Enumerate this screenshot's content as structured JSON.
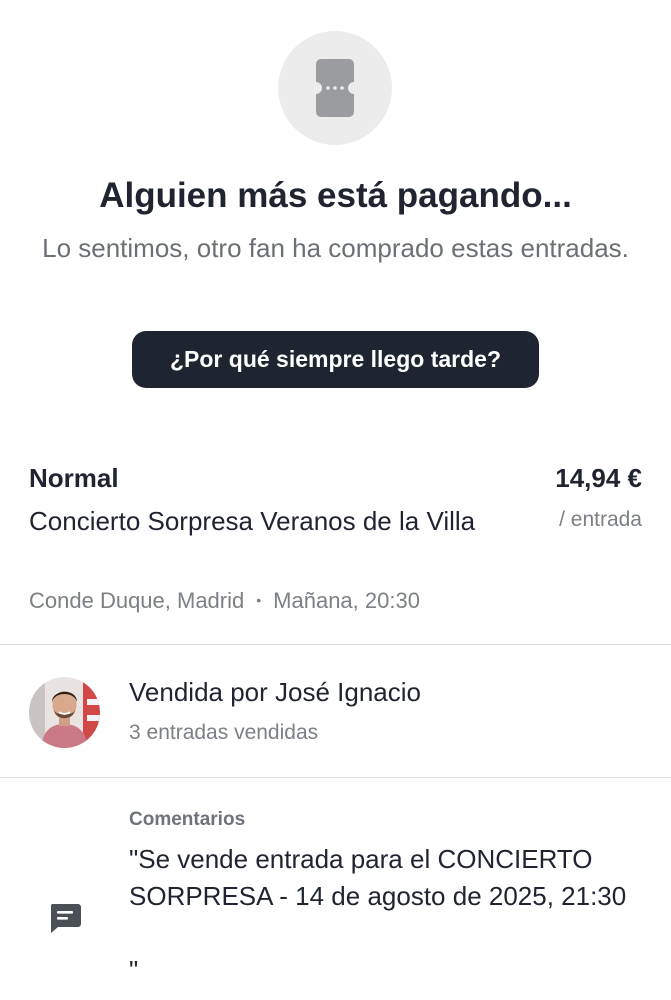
{
  "status": {
    "icon": "ticket-icon",
    "title": "Alguien más está pagando...",
    "subtitle": "Lo sentimos, otro fan ha comprado estas entradas."
  },
  "action": {
    "why_label": "¿Por qué siempre llego tarde?"
  },
  "ticket": {
    "type": "Normal",
    "price": "14,94 €",
    "price_unit": "/ entrada",
    "event_name": "Concierto Sorpresa Veranos de la Villa",
    "venue": "Conde Duque, Madrid",
    "separator": "•",
    "date": "Mañana, 20:30"
  },
  "seller": {
    "name": "Vendida por José Ignacio",
    "sold_count": "3 entradas vendidas",
    "avatar_icon": "avatar"
  },
  "comments": {
    "icon": "comment-icon",
    "label": "Comentarios",
    "text": "\"Se vende entrada para el CONCIERTO SORPRESA - 14 de agosto de 2025, 21:30\n\n\""
  },
  "colors": {
    "primary_dark": "#1e2530",
    "text": "#1f2430",
    "muted": "#7c8086",
    "icon_bg": "#ececec",
    "icon_fg": "#9a9ca0",
    "divider": "#dcdcdc"
  }
}
